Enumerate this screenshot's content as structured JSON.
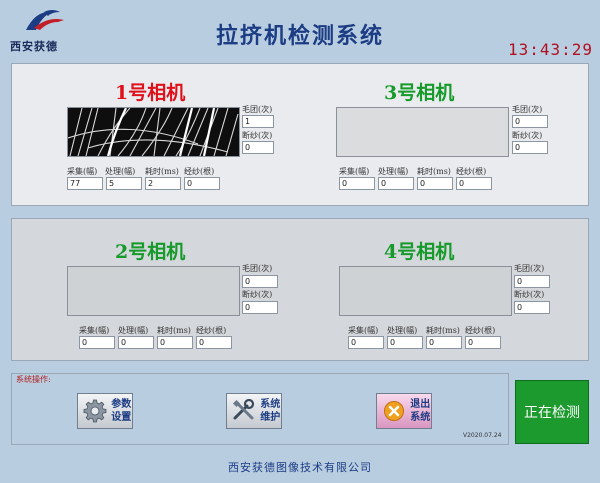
{
  "header": {
    "logo_text": "西安获德",
    "app_title": "拉挤机检测系统",
    "clock": "13:43:29"
  },
  "colors": {
    "camera1_title": "#e0101a",
    "camera_title_green": "#169a2a",
    "status_button": "#1c9a2e",
    "clock": "#b01020",
    "title": "#1c3c84"
  },
  "cameras": [
    {
      "title": "1号相机",
      "fuzz_label": "毛团(次)",
      "fuzz_value": "1",
      "break_label": "断纱(次)",
      "break_value": "0",
      "stats": {
        "collect_label": "采集(幅)",
        "collect": "77",
        "process_label": "处理(幅)",
        "process": "5",
        "time_label": "耗时(ms)",
        "time": "2",
        "warp_label": "经纱(根)",
        "warp": "0"
      }
    },
    {
      "title": "3号相机",
      "fuzz_label": "毛团(次)",
      "fuzz_value": "0",
      "break_label": "断纱(次)",
      "break_value": "0",
      "stats": {
        "collect_label": "采集(幅)",
        "collect": "0",
        "process_label": "处理(幅)",
        "process": "0",
        "time_label": "耗时(ms)",
        "time": "0",
        "warp_label": "经纱(根)",
        "warp": "0"
      }
    },
    {
      "title": "2号相机",
      "fuzz_label": "毛团(次)",
      "fuzz_value": "0",
      "break_label": "断纱(次)",
      "break_value": "0",
      "stats": {
        "collect_label": "采集(幅)",
        "collect": "0",
        "process_label": "处理(幅)",
        "process": "0",
        "time_label": "耗时(ms)",
        "time": "0",
        "warp_label": "经纱(根)",
        "warp": "0"
      }
    },
    {
      "title": "4号相机",
      "fuzz_label": "毛团(次)",
      "fuzz_value": "0",
      "break_label": "断纱(次)",
      "break_value": "0",
      "stats": {
        "collect_label": "采集(幅)",
        "collect": "0",
        "process_label": "处理(幅)",
        "process": "0",
        "time_label": "耗时(ms)",
        "time": "0",
        "warp_label": "经纱(根)",
        "warp": "0"
      }
    }
  ],
  "operations": {
    "group_label": "系统操作:",
    "params_button": "参数设置",
    "maintenance_button": "系统维护",
    "exit_button": "退出系统",
    "params_icon": "gear-icon",
    "maintenance_icon": "tools-icon",
    "exit_icon": "close-icon",
    "version": "V2020.07.24"
  },
  "status_button": "正在检测",
  "footer": "西安获德图像技术有限公司"
}
